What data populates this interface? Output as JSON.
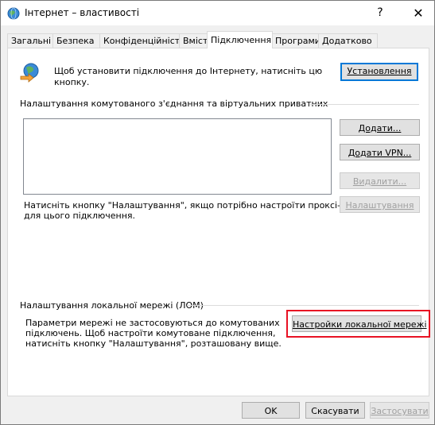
{
  "window": {
    "title": "Інтернет – властивості",
    "help_glyph": "?",
    "close_glyph": "✕"
  },
  "tabs": [
    {
      "label": "Загальні"
    },
    {
      "label": "Безпека"
    },
    {
      "label": "Конфіденційність"
    },
    {
      "label": "Вміст"
    },
    {
      "label": "Підключення"
    },
    {
      "label": "Програми"
    },
    {
      "label": "Додатково"
    }
  ],
  "connection": {
    "setup_text": "Щоб установити підключення до Інтернету, натисніть цю кнопку.",
    "setup_button": "Установлення",
    "dialup_heading": "Налаштування комутованого з'єднання та віртуальних приватних",
    "add_button": "Додати...",
    "add_vpn_button": "Додати VPN...",
    "remove_button": "Видалити...",
    "settings_button": "Налаштування",
    "proxy_text_line1": "Натисніть кнопку \"Налаштування\", якщо потрібно настроїти проксі-сервер",
    "proxy_text_line2": "для цього підключення."
  },
  "lan": {
    "heading": "Налаштування локальної мережі (ЛОМ)",
    "text_line1": "Параметри мережі не застосовуються до комутованих",
    "text_line2": "підключень. Щоб настроїти комутоване підключення,",
    "text_line3": "натисніть кнопку \"Налаштування\", розташовану вище.",
    "lan_button": "Настройки локальної мережі"
  },
  "footer": {
    "ok_button": "OK",
    "cancel_button": "Скасувати",
    "apply_button": "Застосувати"
  },
  "colors": {
    "highlight": "#e81123",
    "default_button_border": "#0078d7"
  }
}
